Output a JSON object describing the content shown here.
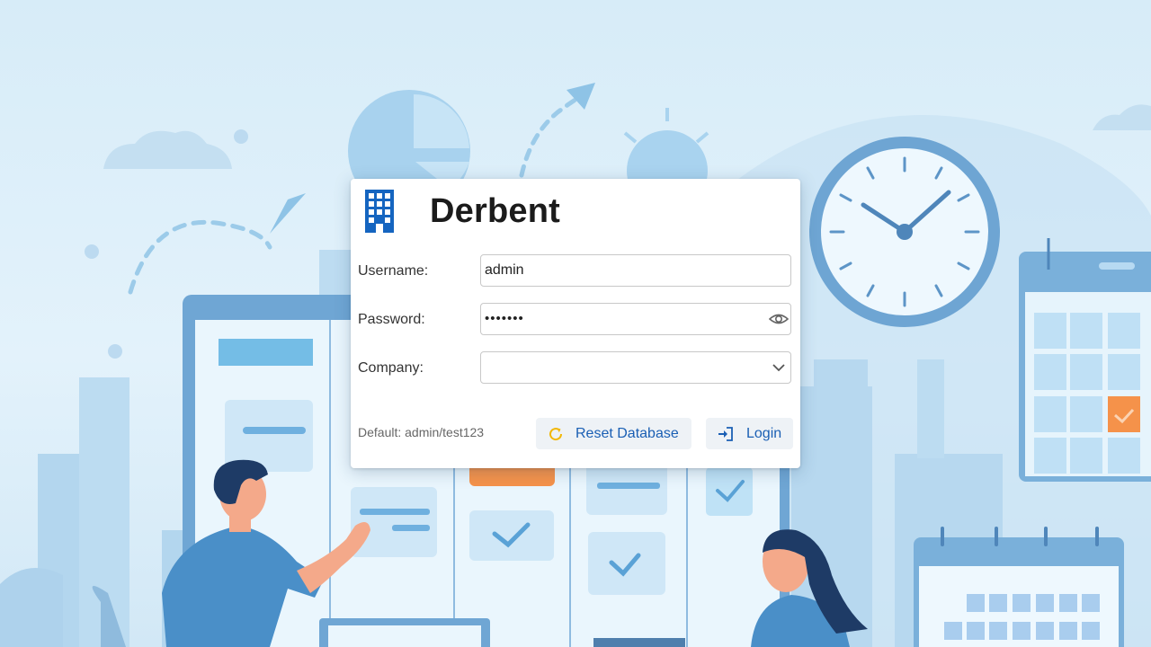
{
  "app": {
    "title": "Derbent"
  },
  "form": {
    "username": {
      "label": "Username:",
      "value": "admin"
    },
    "password": {
      "label": "Password:",
      "value": "•••••••"
    },
    "company": {
      "label": "Company:",
      "value": ""
    },
    "hint": "Default: admin/test123"
  },
  "actions": {
    "reset_label": "Reset Database",
    "login_label": "Login"
  },
  "icons": {
    "brand": "building-icon",
    "password_toggle": "eye-icon",
    "company_dropdown": "chevron-down-icon",
    "reset": "refresh-icon",
    "login": "sign-in-icon"
  },
  "colors": {
    "accent": "#1a5fb4",
    "brand_icon": "#1565c0",
    "reset_icon": "#f2b705"
  }
}
